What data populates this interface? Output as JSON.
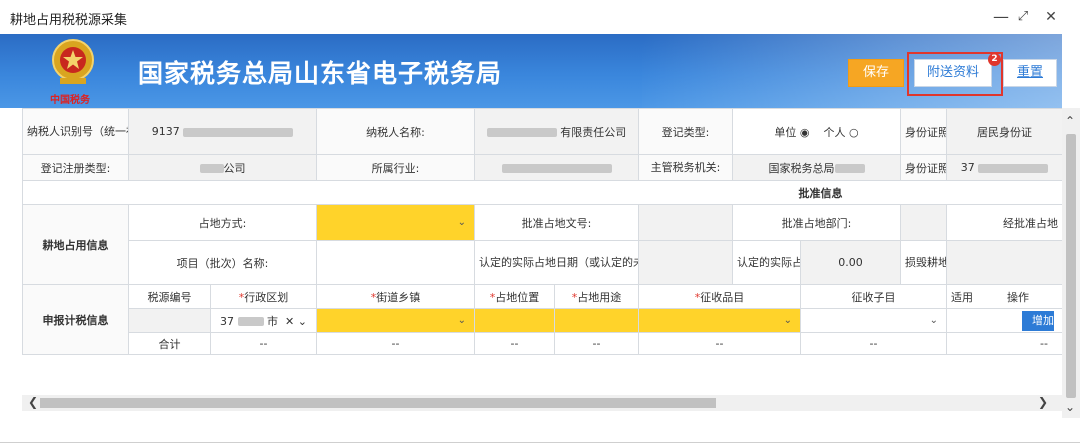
{
  "window": {
    "title": "耕地占用税税源采集",
    "controls": [
      "—",
      "⤢",
      "✕"
    ]
  },
  "banner": {
    "title": "国家税务总局山东省电子税务局",
    "emblem_text": "中国税务",
    "buttons": {
      "save": "保存",
      "attach": "附送资料",
      "reset": "重置"
    },
    "badge_count": "2"
  },
  "taxpayer": {
    "id_label": "纳税人识别号（统一社会信用代码）：",
    "id_value_prefix": "9137",
    "name_label": "纳税人名称:",
    "name_value_suffix": "有限责任公司",
    "reg_type_label": "登记类型:",
    "unit_option": "单位",
    "individual_option": "个人",
    "id_type_label": "身份证照类型:",
    "id_type_value": "居民身份证",
    "reg_reg_type_label": "登记注册类型:",
    "reg_reg_type_value": "公司",
    "industry_label": "所属行业:",
    "authority_label": "主管税务机关:",
    "authority_value": "国家税务总局",
    "id_number_label": "身份证照号码:",
    "id_number_prefix": "37"
  },
  "approval": {
    "section_title": "批准信息",
    "group_label": "耕地占用信息",
    "method_label": "占地方式:",
    "doc_no_label": "批准占地文号:",
    "dept_label": "批准占地部门:",
    "approved_area_label": "经批准占地",
    "project_label": "项目（批次）名称:",
    "actual_date_label": "认定的实际占地日期（或认定的未经批准改变原占地用途日期）：",
    "actual_area_label": "认定的实际占地面积:",
    "actual_area_value": "0.00",
    "damage_label": "损毁耕地:"
  },
  "declaration": {
    "group_label": "申报计税信息",
    "columns": [
      "税源编号",
      "行政区划",
      "街道乡镇",
      "占地位置",
      "占地用途",
      "征收品目",
      "征收子目",
      "适用",
      "操作"
    ],
    "region_prefix": "37",
    "region_suffix": "市",
    "add_button": "增加",
    "total_label": "合计",
    "total_values": [
      "--",
      "--",
      "--",
      "--",
      "--",
      "--",
      "--",
      "--"
    ]
  }
}
